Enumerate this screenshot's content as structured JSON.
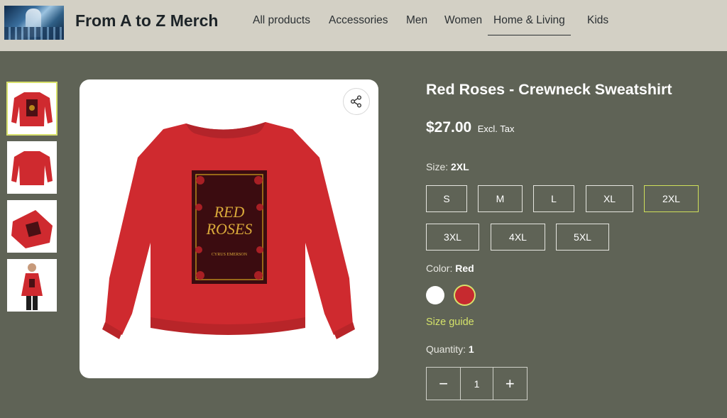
{
  "header": {
    "brand": "From A to Z Merch",
    "nav": [
      {
        "label": "All products",
        "active": false
      },
      {
        "label": "Accessories",
        "active": false
      },
      {
        "label": "Men",
        "active": false
      },
      {
        "label": "Women",
        "active": false
      },
      {
        "label": "Home & Living",
        "active": true
      },
      {
        "label": "Kids",
        "active": false
      }
    ]
  },
  "product": {
    "title": "Red Roses - Crewneck Sweatshirt",
    "price": "$27.00",
    "tax_note": "Excl. Tax",
    "design_title": "RED ROSES",
    "design_author": "CYRUS EMERSON",
    "size": {
      "label": "Size:",
      "selected": "2XL",
      "options": [
        "S",
        "M",
        "L",
        "XL",
        "2XL",
        "3XL",
        "4XL",
        "5XL"
      ]
    },
    "color": {
      "label": "Color:",
      "selected": "Red",
      "options": [
        {
          "name": "White",
          "hex": "#ffffff"
        },
        {
          "name": "Red",
          "hex": "#c62a2f"
        }
      ]
    },
    "size_guide": "Size guide",
    "quantity": {
      "label": "Quantity:",
      "value": "1",
      "minus": "−",
      "plus": "+"
    }
  },
  "colors": {
    "header_bg": "#d3d0c5",
    "page_bg": "#5f6356",
    "accent": "#cfe05a",
    "sweatshirt": "#cf2a2f"
  }
}
